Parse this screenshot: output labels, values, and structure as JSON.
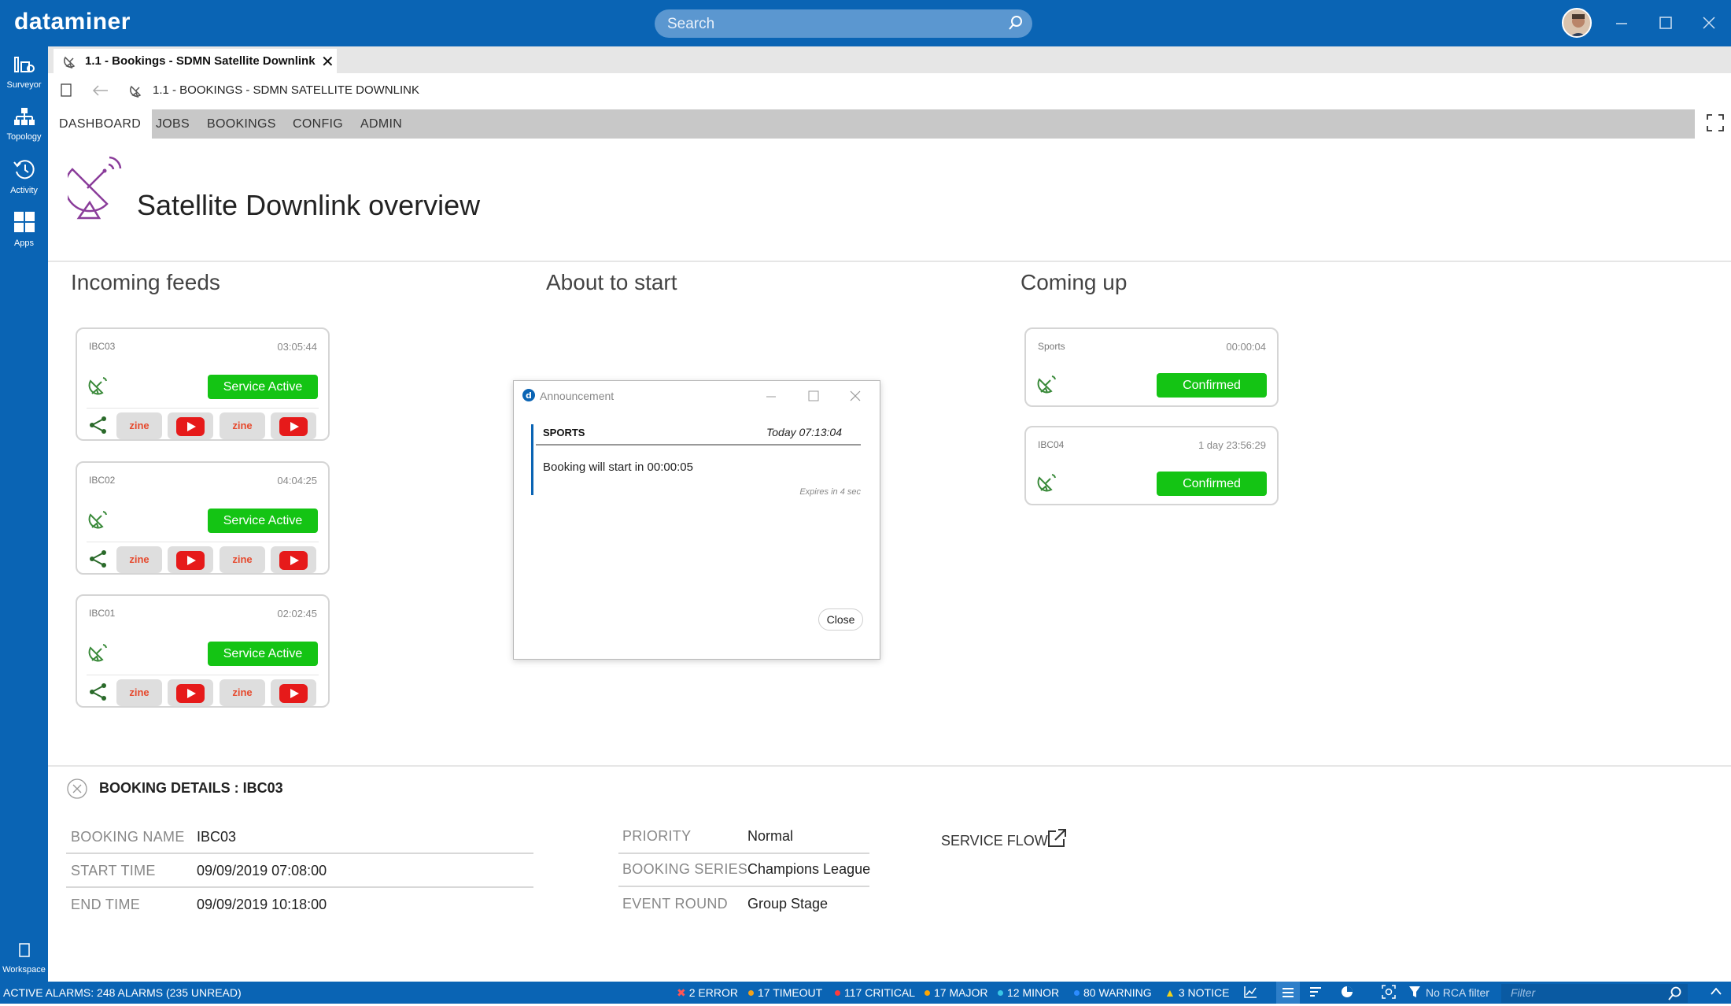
{
  "app": {
    "logo": "dataminer"
  },
  "search": {
    "placeholder": "Search"
  },
  "rail": {
    "items": [
      {
        "label": "Surveyor"
      },
      {
        "label": "Topology"
      },
      {
        "label": "Activity"
      },
      {
        "label": "Apps"
      }
    ],
    "workspace": "Workspace"
  },
  "tab": {
    "label": "1.1 - Bookings - SDMN Satellite Downlink",
    "close": "✕"
  },
  "breadcrumb": {
    "path": "1.1 - BOOKINGS - SDMN SATELLITE DOWNLINK"
  },
  "nav": {
    "tabs": [
      "DASHBOARD",
      "JOBS",
      "BOOKINGS",
      "CONFIG",
      "ADMIN"
    ]
  },
  "page": {
    "title": "Satellite Downlink overview"
  },
  "columns": {
    "incoming": "Incoming feeds",
    "about": "About to start",
    "coming": "Coming up"
  },
  "incoming_feeds": [
    {
      "name": "IBC03",
      "time": "03:05:44",
      "status": "Service Active",
      "zine": "zine"
    },
    {
      "name": "IBC02",
      "time": "04:04:25",
      "status": "Service Active",
      "zine": "zine"
    },
    {
      "name": "IBC01",
      "time": "02:02:45",
      "status": "Service Active",
      "zine": "zine"
    }
  ],
  "coming_up": [
    {
      "name": "Sports",
      "time": "00:00:04",
      "status": "Confirmed"
    },
    {
      "name": "IBC04",
      "time": "1 day 23:56:29",
      "status": "Confirmed"
    }
  ],
  "announcement": {
    "title": "Announcement",
    "category": "SPORTS",
    "time": "Today 07:13:04",
    "message": "Booking will start in 00:00:05",
    "expires": "Expires in 4 sec",
    "close": "Close"
  },
  "booking_details": {
    "title": "BOOKING DETAILS : IBC03",
    "booking_name_label": "BOOKING NAME",
    "booking_name": "IBC03",
    "start_time_label": "START TIME",
    "start_time": "09/09/2019 07:08:00",
    "end_time_label": "END TIME",
    "end_time": "09/09/2019 10:18:00",
    "priority_label": "PRIORITY",
    "priority": "Normal",
    "series_label": "BOOKING SERIES",
    "series": "Champions League",
    "round_label": "EVENT ROUND",
    "round": "Group Stage",
    "service_flow": "SERVICE FLOW"
  },
  "statusbar": {
    "alarms": "ACTIVE ALARMS: 248 ALARMS (235 UNREAD)",
    "error": "2 ERROR",
    "timeout": "17 TIMEOUT",
    "critical": "117 CRITICAL",
    "major": "17 MAJOR",
    "minor": "12 MINOR",
    "warning": "80 WARNING",
    "notice": "3 NOTICE",
    "rca": "No RCA filter",
    "filter_placeholder": "Filter"
  },
  "colors": {
    "brand": "#0a64b4",
    "active_green": "#14c414",
    "error": "#e02020",
    "timeout": "#f2a21a",
    "critical": "#ff3b3b",
    "major": "#ffa500",
    "minor": "#39c6e6",
    "warning": "#2d8cff",
    "notice": "#f2d21a"
  }
}
